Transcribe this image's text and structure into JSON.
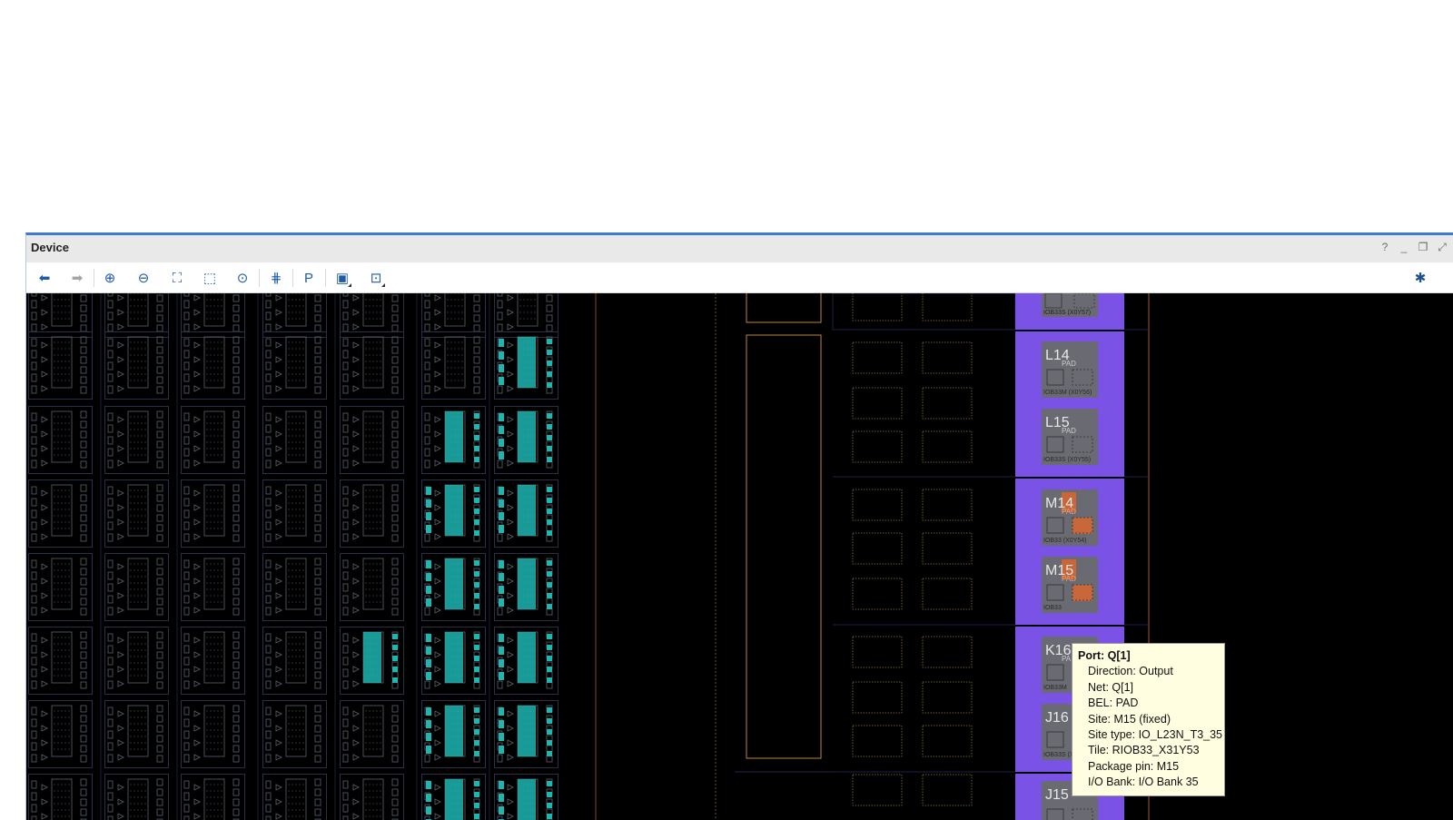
{
  "window": {
    "title": "Device"
  },
  "window_controls": [
    {
      "name": "help-icon",
      "glyph": "?"
    },
    {
      "name": "minimize-icon",
      "glyph": "_"
    },
    {
      "name": "restore-icon",
      "glyph": "❐"
    },
    {
      "name": "maximize-icon",
      "glyph": "⤢"
    }
  ],
  "toolbar": {
    "buttons": [
      {
        "name": "back-button",
        "icon": "arrow-left-icon",
        "glyph": "⬅",
        "enabled": true
      },
      {
        "name": "forward-button",
        "icon": "arrow-right-icon",
        "glyph": "➡",
        "enabled": false
      },
      {
        "name": "zoom-in-button",
        "icon": "zoom-in-icon",
        "glyph": "⊕",
        "enabled": true
      },
      {
        "name": "zoom-out-button",
        "icon": "zoom-out-icon",
        "glyph": "⊖",
        "enabled": true
      },
      {
        "name": "zoom-fit-button",
        "icon": "fit-icon",
        "glyph": "⛶",
        "enabled": true
      },
      {
        "name": "zoom-selected-button",
        "icon": "zoom-selected-icon",
        "glyph": "⬚",
        "enabled": true
      },
      {
        "name": "autofit-selection-button",
        "icon": "crosshair-icon",
        "glyph": "⊙",
        "enabled": true
      },
      {
        "name": "routing-resources-button",
        "icon": "routing-icon",
        "glyph": "⋕",
        "enabled": true
      },
      {
        "name": "create-pblock-button",
        "icon": "pblock-add-icon",
        "glyph": "P",
        "enabled": true
      },
      {
        "name": "device-view-options-button",
        "icon": "box-select-icon",
        "glyph": "▣",
        "enabled": true
      },
      {
        "name": "show-connections-button",
        "icon": "net-connect-icon",
        "glyph": "⊡",
        "enabled": true
      }
    ],
    "settings_icon": "gear-icon"
  },
  "io_sites": [
    {
      "pin": "L14",
      "bel": "PAD",
      "site": "IOB33M (X0Y56)",
      "highlighted": false
    },
    {
      "pin": "L15",
      "bel": "PAD",
      "site": "IOB33S (X0Y55)",
      "highlighted": false
    },
    {
      "pin": "M14",
      "bel": "PAD",
      "site": "IOB33 (X0Y54)",
      "highlighted": true
    },
    {
      "pin": "M15",
      "bel": "PAD",
      "site": "IOB33",
      "highlighted": true
    },
    {
      "pin": "K16",
      "bel": "PA",
      "site": "IOB33M",
      "highlighted": false
    },
    {
      "pin": "J16",
      "bel": "",
      "site": "IOB33S (X0Y51)",
      "highlighted": false
    },
    {
      "pin": "J15",
      "bel": "",
      "site": "",
      "highlighted": false
    }
  ],
  "io_top_site_label": "IOB33S (X0Y57)",
  "colors": {
    "io_column": "#7b52e6",
    "io_tile": "#6a6a72",
    "io_highlight": "#c8683a",
    "clb_outline": "#5c6270",
    "clb_used": "#1fb5b0",
    "bram_outline": "#b7873a",
    "canvas": "#000000"
  },
  "tooltip": {
    "title": "Port: Q[1]",
    "lines": [
      "Direction: Output",
      "Net: Q[1]",
      "BEL: PAD",
      "Site: M15 (fixed)",
      "Site type: IO_L23N_T3_35",
      "Tile: RIOB33_X31Y53",
      "Package pin: M15",
      "I/O Bank: I/O Bank 35"
    ]
  }
}
